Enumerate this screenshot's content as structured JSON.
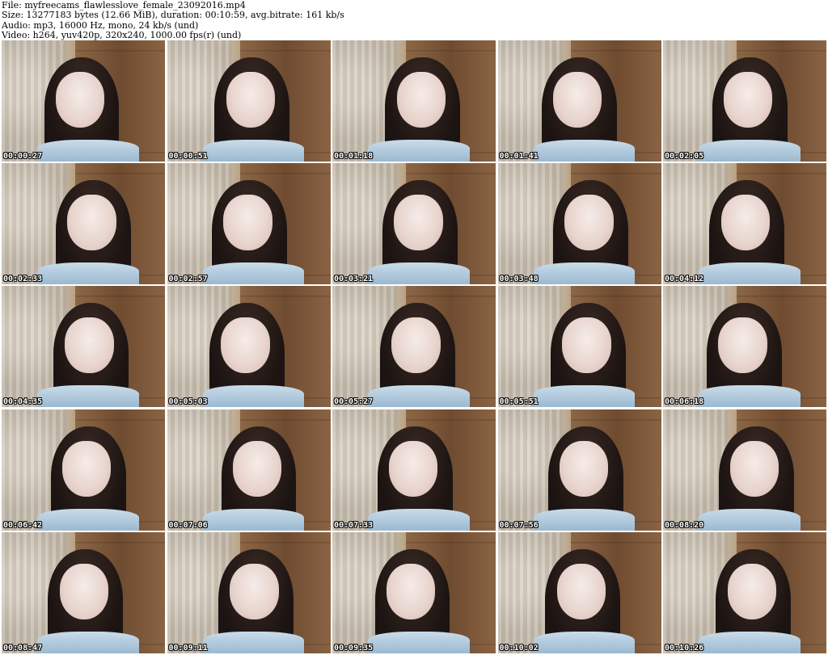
{
  "header": {
    "file_line": "File: myfreecams_flawlesslove_female_23092016.mp4",
    "size_line": "Size: 13277183 bytes (12.66 MiB), duration: 00:10:59, avg.bitrate: 161 kb/s",
    "audio_line": "Audio: mp3, 16000 Hz, mono, 24 kb/s (und)",
    "video_line": "Video: h264, yuv420p, 320x240, 1000.00 fps(r) (und)"
  },
  "thumbnails": [
    {
      "timestamp": "00:00:27"
    },
    {
      "timestamp": "00:00:51"
    },
    {
      "timestamp": "00:01:18"
    },
    {
      "timestamp": "00:01:41"
    },
    {
      "timestamp": "00:02:05"
    },
    {
      "timestamp": "00:02:33"
    },
    {
      "timestamp": "00:02:57"
    },
    {
      "timestamp": "00:03:21"
    },
    {
      "timestamp": "00:03:48"
    },
    {
      "timestamp": "00:04:12"
    },
    {
      "timestamp": "00:04:35"
    },
    {
      "timestamp": "00:05:03"
    },
    {
      "timestamp": "00:05:27"
    },
    {
      "timestamp": "00:05:51"
    },
    {
      "timestamp": "00:06:18"
    },
    {
      "timestamp": "00:06:42"
    },
    {
      "timestamp": "00:07:06"
    },
    {
      "timestamp": "00:07:33"
    },
    {
      "timestamp": "00:07:56"
    },
    {
      "timestamp": "00:08:20"
    },
    {
      "timestamp": "00:08:47"
    },
    {
      "timestamp": "00:09:11"
    },
    {
      "timestamp": "00:09:35"
    },
    {
      "timestamp": "00:10:02"
    },
    {
      "timestamp": "00:10:26"
    }
  ]
}
